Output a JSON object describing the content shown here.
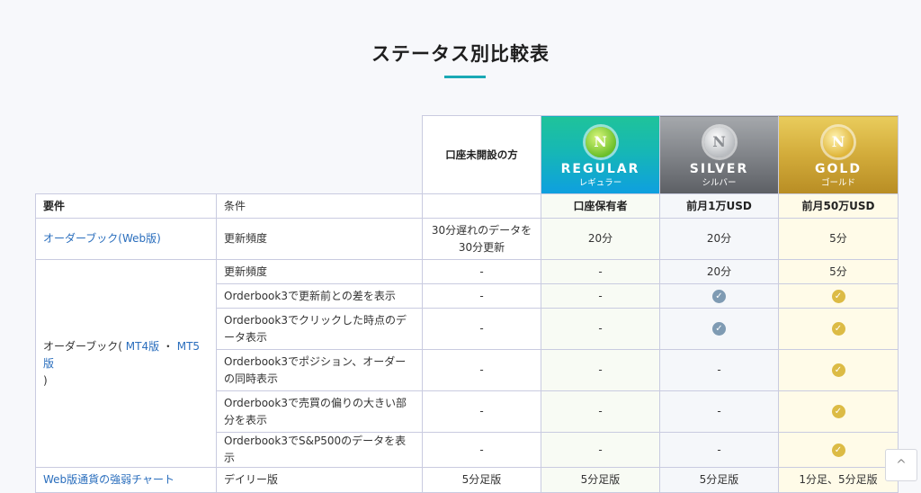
{
  "title": "ステータス別比較表",
  "header": {
    "no_account": "口座未開設の方",
    "tiers": [
      {
        "en": "REGULAR",
        "jp": "レギュラー",
        "icon": "coin-n-icon",
        "glyph": "N"
      },
      {
        "en": "SILVER",
        "jp": "シルバー",
        "icon": "coin-n-icon",
        "glyph": "N"
      },
      {
        "en": "GOLD",
        "jp": "ゴールド",
        "icon": "coin-n-icon",
        "glyph": "N"
      }
    ]
  },
  "label_row": {
    "requirement": "要件",
    "condition": "条件",
    "regular": "口座保有者",
    "silver": "前月1万USD",
    "gold": "前月50万USD"
  },
  "rows": {
    "web": {
      "section": "オーダーブック(Web版)",
      "condition": "更新頻度",
      "none": "30分遅れのデータを30分更新",
      "regular": "20分",
      "silver": "20分",
      "gold": "5分"
    },
    "mt": {
      "section_prefix": "オーダーブック( ",
      "section_link1": "MT4版",
      "section_sep": " ・ ",
      "section_link2": "MT5版",
      "section_suffix": " )",
      "items": [
        {
          "condition": "更新頻度",
          "none": "-",
          "regular": "-",
          "silver": "20分",
          "gold": "5分"
        },
        {
          "condition": "Orderbook3で更新前との差を表示",
          "none": "-",
          "regular": "-",
          "silver": "check",
          "gold": "check"
        },
        {
          "condition": "Orderbook3でクリックした時点のデータ表示",
          "none": "-",
          "regular": "-",
          "silver": "check",
          "gold": "check"
        },
        {
          "condition": "Orderbook3でポジション、オーダーの同時表示",
          "none": "-",
          "regular": "-",
          "silver": "-",
          "gold": "check"
        },
        {
          "condition": "Orderbook3で売買の偏りの大きい部分を表示",
          "none": "-",
          "regular": "-",
          "silver": "-",
          "gold": "check"
        },
        {
          "condition": "Orderbook3でS&P500のデータを表示",
          "none": "-",
          "regular": "-",
          "silver": "-",
          "gold": "check"
        }
      ]
    },
    "chart": {
      "section": "Web版通貨の強弱チャート",
      "condition": "デイリー版",
      "none": "5分足版",
      "regular": "5分足版",
      "silver": "5分足版",
      "gold": "1分足、5分足版"
    }
  },
  "check_glyph": "✓",
  "scroll_top_glyph": "^",
  "colors": {
    "accent": "#1aa9b5",
    "link": "#2a6ebd",
    "silver_check": "#7f9bb3",
    "gold_check": "#dcbb45"
  }
}
